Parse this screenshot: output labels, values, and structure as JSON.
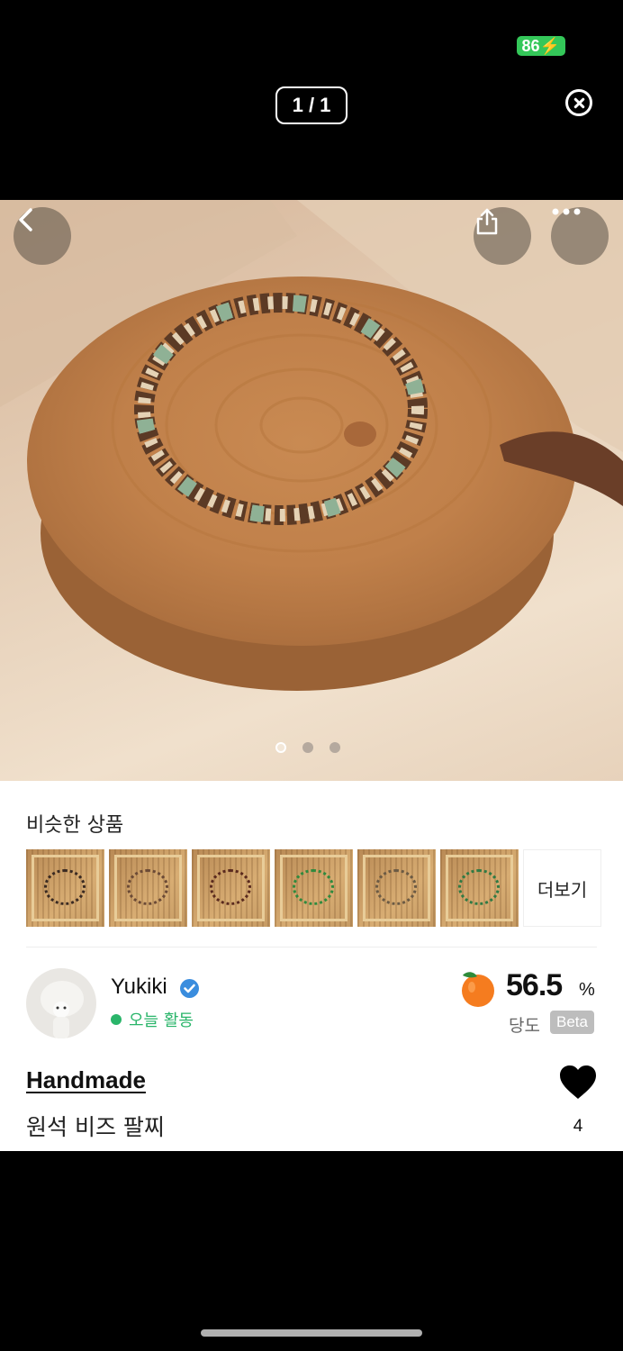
{
  "status_bar": {
    "battery": "86"
  },
  "viewer": {
    "counter": "1 / 1"
  },
  "gallery": {
    "page_count": 3,
    "active_index": 0
  },
  "similar": {
    "title": "비슷한 상품",
    "more_label": "더보기",
    "items": [
      {
        "ring_color": "#3a2a22"
      },
      {
        "ring_color": "#6b4a36"
      },
      {
        "ring_color": "#5a2a1e"
      },
      {
        "ring_color": "#2f8a3e"
      },
      {
        "ring_color": "#6b5a44"
      },
      {
        "ring_color": "#2f7a44"
      }
    ]
  },
  "seller": {
    "name": "Yukiki",
    "activity": "오늘 활동",
    "temperature": "56.5",
    "temperature_unit": "%",
    "temperature_label": "당도",
    "badge": "Beta"
  },
  "product": {
    "title": "Handmade",
    "subtitle": "원석 비즈 팔찌",
    "likes": "4"
  },
  "colors": {
    "accent_green": "#2ab56a",
    "verified_blue": "#3a8dde",
    "battery_green": "#34c759"
  }
}
